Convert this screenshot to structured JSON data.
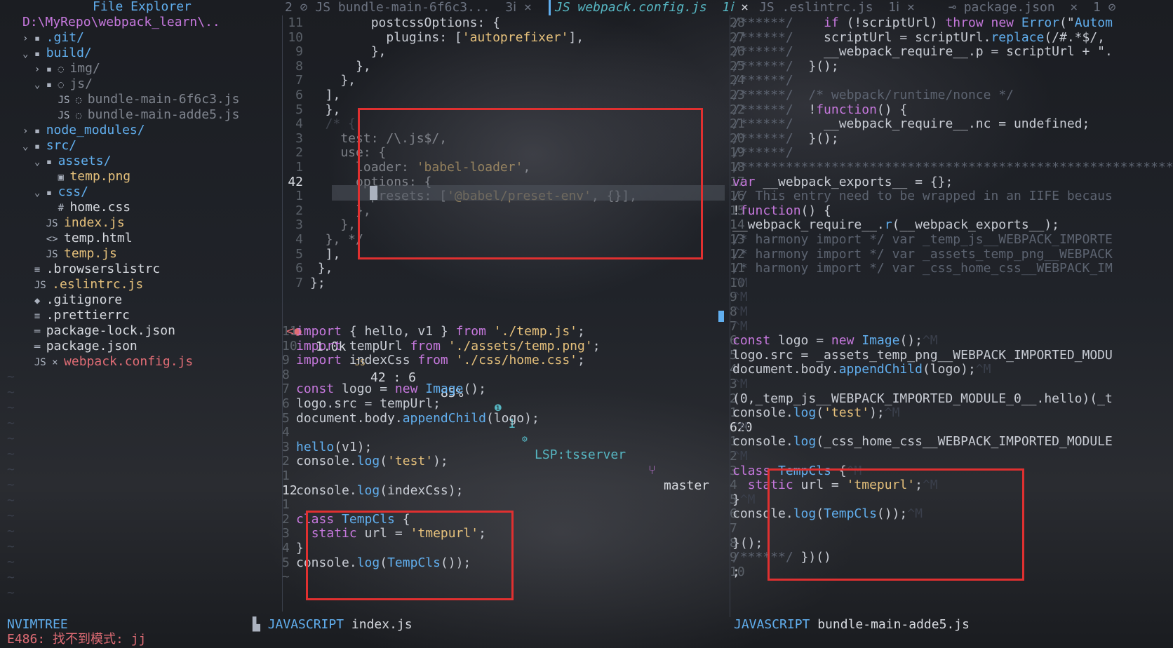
{
  "explorer": {
    "title": "File Explorer",
    "path": "D:\\MyRepo\\webpack_learn\\..",
    "items": [
      {
        "indent": "› ",
        "icon": "▪ ",
        "label": ".git/",
        "cls": "dir"
      },
      {
        "indent": "⌄ ",
        "icon": "▪ ",
        "label": "build/",
        "cls": "dir"
      },
      {
        "indent": "  › ",
        "icon": "▪ ◌ ",
        "label": "img/",
        "cls": "gray"
      },
      {
        "indent": "  ⌄ ",
        "icon": "▪ ◌ ",
        "label": "js/",
        "cls": "gray"
      },
      {
        "indent": "      ",
        "icon": "JS ◌ ",
        "label": "bundle-main-6f6c3.js",
        "cls": "gray"
      },
      {
        "indent": "      ",
        "icon": "JS ◌ ",
        "label": "bundle-main-adde5.js",
        "cls": "gray"
      },
      {
        "indent": "› ",
        "icon": "▪ ",
        "label": "node_modules/",
        "cls": "dir"
      },
      {
        "indent": "⌄ ",
        "icon": "▪ ",
        "label": "src/",
        "cls": "dir"
      },
      {
        "indent": "  ⌄ ",
        "icon": "▪ ",
        "label": "assets/",
        "cls": "dir"
      },
      {
        "indent": "      ",
        "icon": "▣ ",
        "label": "temp.png",
        "cls": "str"
      },
      {
        "indent": "  ⌄ ",
        "icon": "▪ ",
        "label": "css/",
        "cls": "dir"
      },
      {
        "indent": "      ",
        "icon": "# ",
        "label": "home.css",
        "cls": "white"
      },
      {
        "indent": "    ",
        "icon": "JS ",
        "label": "index.js",
        "cls": "str"
      },
      {
        "indent": "    ",
        "icon": "<> ",
        "label": "temp.html",
        "cls": "white"
      },
      {
        "indent": "    ",
        "icon": "JS ",
        "label": "temp.js",
        "cls": "str"
      },
      {
        "indent": "  ",
        "icon": "≡ ",
        "label": ".browserslistrc",
        "cls": "white"
      },
      {
        "indent": "  ",
        "icon": "JS ",
        "label": ".eslintrc.js",
        "cls": "str"
      },
      {
        "indent": "  ",
        "icon": "◆ ",
        "label": ".gitignore",
        "cls": "white"
      },
      {
        "indent": "  ",
        "icon": "≡ ",
        "label": ".prettierrc",
        "cls": "white"
      },
      {
        "indent": "  ",
        "icon": "═ ",
        "label": "package-lock.json",
        "cls": "white"
      },
      {
        "indent": "  ",
        "icon": "═ ",
        "label": "package.json",
        "cls": "white"
      },
      {
        "indent": "  ",
        "icon": "JS × ",
        "label": "webpack.config.js",
        "cls": "red"
      }
    ],
    "statusline": "NVIMTREE"
  },
  "tabs": [
    {
      "num": "2",
      "label": "JS bundle-main-6f6c3...",
      "mark": "3"
    },
    {
      "num": "",
      "label": "JS webpack.config.js",
      "mark": "1"
    },
    {
      "num": "",
      "label": "JS .eslintrc.js",
      "mark": "1"
    },
    {
      "num": "",
      "label": "package.json",
      "mark": "1"
    }
  ],
  "top_editor": {
    "linenos": [
      "11",
      "10",
      "9",
      "8",
      "7",
      "6",
      "5",
      "4",
      "3",
      "2",
      "1",
      "42",
      "1",
      "2",
      "3",
      "4",
      "5",
      "6",
      "7"
    ],
    "lines": [
      "        postcssOptions: {",
      "          plugins: ['autoprefixer'],",
      "        },",
      "      },",
      "    },",
      "  ],",
      "  },",
      "  /* {",
      "    test: /\\.js$/,",
      "    use: {",
      "      loader: 'babel-loader',",
      "      options: {",
      "        presets: ['@babel/preset-env', {}],",
      "      },",
      "    },",
      "  }, */",
      "  ],",
      " },",
      "};"
    ]
  },
  "status": {
    "size": "1.0k",
    "pos": "42 : 6",
    "pct": "85%",
    "diag": "1",
    "lsp": "LSP:tsserver",
    "branch": "master"
  },
  "index_editor": {
    "linenos": [
      "11",
      "10",
      "9",
      "8",
      "7",
      "6",
      "5",
      "4",
      "3",
      "2",
      "1",
      "12",
      "1",
      "2",
      "3",
      "4",
      "5",
      "~"
    ],
    "lines": [
      "import { hello, v1 } from './temp.js';",
      "import tempUrl from './assets/temp.png';",
      "import indexCss from './css/home.css';",
      "",
      "const logo = new Image();",
      "logo.src = tempUrl;",
      "document.body.appendChild(logo);",
      "",
      "hello(v1);",
      "console.log('test');",
      "",
      "console.log(indexCss);",
      "",
      "class TempCls {",
      "  static url = 'tmepurl';",
      "}",
      "console.log(TempCls());",
      ""
    ],
    "statusline_lang": "JAVASCRIPT",
    "statusline_file": "index.js"
  },
  "bundle_editor": {
    "linenos": [
      "28",
      "27",
      "26",
      "25",
      "24",
      "23",
      "22",
      "21",
      "20",
      "19",
      "18",
      "17",
      "16",
      "15",
      "14",
      "13",
      "12",
      "11",
      "10",
      "9",
      "8",
      "7",
      "6",
      "5",
      "4",
      "3",
      "2",
      "1",
      "620",
      "1",
      "2",
      "3",
      "4",
      "5",
      "6",
      "7",
      "8",
      "9",
      "10"
    ],
    "lines": [
      "/******/    if (!scriptUrl) throw new Error(\"Autom",
      "/******/    scriptUrl = scriptUrl.replace(/#.*$/,",
      "/******/    __webpack_require__.p = scriptUrl + \".",
      "/******/  }();",
      "/******/",
      "/******/  /* webpack/runtime/nonce */",
      "/******/  !function() {",
      "/******/    __webpack_require__.nc = undefined;",
      "/******/  }();",
      "/******/",
      "/************************************************************",
      "var __webpack_exports__ = {};",
      "// This entry need to be wrapped in an IIFE becaus",
      "!function() {",
      "__webpack_require__.r(__webpack_exports__);",
      "/* harmony import */ var _temp_js__WEBPACK_IMPORTE",
      "/* harmony import */ var _assets_temp_png__WEBPACK",
      "/* harmony import */ var _css_home_css__WEBPACK_IM",
      "^M",
      "^M",
      "^M",
      "^M",
      "const logo = new Image();^M",
      "logo.src = _assets_temp_png__WEBPACK_IMPORTED_MODU",
      "document.body.appendChild(logo);^M",
      "^M",
      "(0,_temp_js__WEBPACK_IMPORTED_MODULE_0__.hello)(_t",
      "console.log('test');^M",
      "^M",
      "console.log(_css_home_css__WEBPACK_IMPORTED_MODULE",
      "^M",
      "class TempCls {^M",
      "  static url = 'tmepurl';^M",
      "}^M",
      "console.log(TempCls());^M",
      "",
      "}();",
      "/******/ })()",
      ";"
    ],
    "statusline_lang": "JAVASCRIPT",
    "statusline_file": "bundle-main-adde5.js"
  },
  "cmdline": "E486: 找不到模式: jj"
}
